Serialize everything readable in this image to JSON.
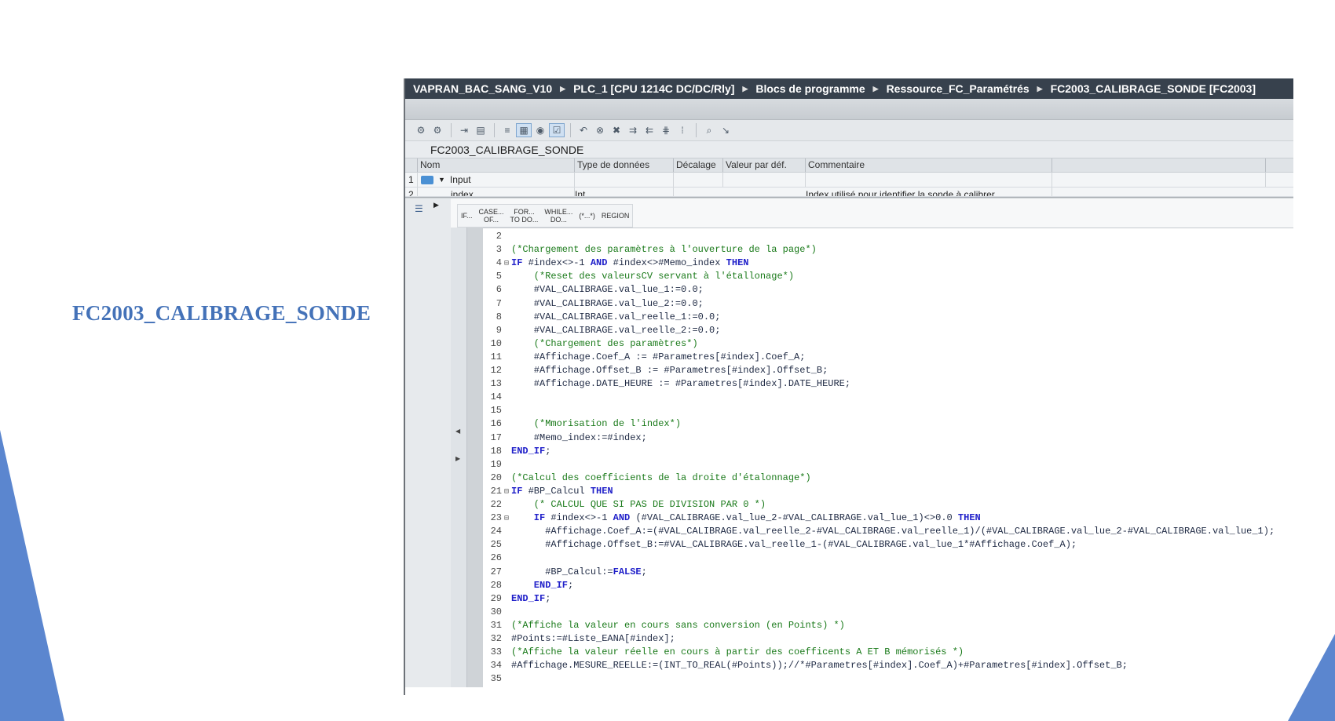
{
  "slide": {
    "title": "FC2003_CALIBRAGE_SONDE"
  },
  "breadcrumb": [
    "VAPRAN_BAC_SANG_V10",
    "PLC_1 [CPU 1214C DC/DC/Rly]",
    "Blocs de programme",
    "Ressource_FC_Paramétrés",
    "FC2003_CALIBRAGE_SONDE [FC2003]"
  ],
  "toolbar": {
    "icons": [
      "compile-icon",
      "compile-all-icon",
      "download-icon",
      "monitor-icon",
      "list-icon",
      "outline-icon",
      "watch-icon",
      "snapshot-icon",
      "bookmark-icon",
      "close-bookmark-icon",
      "delete-icon",
      "indent-icon",
      "outdent-icon",
      "comment-icon",
      "uncomment-icon",
      "zoom-icon",
      "arrow-icon"
    ]
  },
  "block": {
    "name": "FC2003_CALIBRAGE_SONDE"
  },
  "interface": {
    "columns": {
      "num": "",
      "name": "Nom",
      "type": "Type de données",
      "offset": "Décalage",
      "default": "Valeur par déf.",
      "comment": "Commentaire"
    },
    "rows": [
      {
        "num": "1",
        "name": "Input",
        "type": "",
        "comment": ""
      },
      {
        "num": "2",
        "name": "index",
        "type": "Int",
        "comment": "Index utilisé pour identifier la sonde à calibrer"
      }
    ]
  },
  "snippets": [
    "IF...",
    "CASE...\nOF...",
    "FOR...\nTO DO...",
    "WHILE...\nDO...",
    "(*...*)",
    "REGION"
  ],
  "code_lines": [
    {
      "n": "2",
      "fold": "",
      "parts": []
    },
    {
      "n": "3",
      "fold": "",
      "parts": [
        {
          "t": "cm",
          "v": "(*Chargement des paramètres à l'ouverture de la page*)"
        }
      ]
    },
    {
      "n": "4",
      "fold": "⊟",
      "parts": [
        {
          "t": "kw",
          "v": "IF"
        },
        {
          "t": "tx",
          "v": " #index<>-1 "
        },
        {
          "t": "kw",
          "v": "AND"
        },
        {
          "t": "tx",
          "v": " #index<>#Memo_index "
        },
        {
          "t": "kw",
          "v": "THEN"
        }
      ]
    },
    {
      "n": "5",
      "fold": "",
      "parts": [
        {
          "t": "cm",
          "v": "    (*Reset des valeursCV servant à l'étallonage*)"
        }
      ]
    },
    {
      "n": "6",
      "fold": "",
      "parts": [
        {
          "t": "tx",
          "v": "    #VAL_CALIBRAGE.val_lue_1:=0.0;"
        }
      ]
    },
    {
      "n": "7",
      "fold": "",
      "parts": [
        {
          "t": "tx",
          "v": "    #VAL_CALIBRAGE.val_lue_2:=0.0;"
        }
      ]
    },
    {
      "n": "8",
      "fold": "",
      "parts": [
        {
          "t": "tx",
          "v": "    #VAL_CALIBRAGE.val_reelle_1:=0.0;"
        }
      ]
    },
    {
      "n": "9",
      "fold": "",
      "parts": [
        {
          "t": "tx",
          "v": "    #VAL_CALIBRAGE.val_reelle_2:=0.0;"
        }
      ]
    },
    {
      "n": "10",
      "fold": "",
      "parts": [
        {
          "t": "cm",
          "v": "    (*Chargement des paramètres*)"
        }
      ]
    },
    {
      "n": "11",
      "fold": "",
      "parts": [
        {
          "t": "tx",
          "v": "    #Affichage.Coef_A := #Parametres[#index].Coef_A;"
        }
      ]
    },
    {
      "n": "12",
      "fold": "",
      "parts": [
        {
          "t": "tx",
          "v": "    #Affichage.Offset_B := #Parametres[#index].Offset_B;"
        }
      ]
    },
    {
      "n": "13",
      "fold": "",
      "parts": [
        {
          "t": "tx",
          "v": "    #Affichage.DATE_HEURE := #Parametres[#index].DATE_HEURE;"
        }
      ]
    },
    {
      "n": "14",
      "fold": "",
      "parts": []
    },
    {
      "n": "15",
      "fold": "",
      "parts": []
    },
    {
      "n": "16",
      "fold": "",
      "parts": [
        {
          "t": "cm",
          "v": "    (*Mmorisation de l'index*)"
        }
      ]
    },
    {
      "n": "17",
      "fold": "",
      "parts": [
        {
          "t": "tx",
          "v": "    #Memo_index:=#index;"
        }
      ]
    },
    {
      "n": "18",
      "fold": "",
      "parts": [
        {
          "t": "kw",
          "v": "END_IF"
        },
        {
          "t": "tx",
          "v": ";"
        }
      ]
    },
    {
      "n": "19",
      "fold": "",
      "parts": []
    },
    {
      "n": "20",
      "fold": "",
      "parts": [
        {
          "t": "cm",
          "v": "(*Calcul des coefficients de la droite d'étalonnage*)"
        }
      ]
    },
    {
      "n": "21",
      "fold": "⊟",
      "parts": [
        {
          "t": "kw",
          "v": "IF"
        },
        {
          "t": "tx",
          "v": " #BP_Calcul "
        },
        {
          "t": "kw",
          "v": "THEN"
        }
      ]
    },
    {
      "n": "22",
      "fold": "",
      "parts": [
        {
          "t": "cm",
          "v": "    (* CALCUL QUE SI PAS DE DIVISION PAR 0 *)"
        }
      ]
    },
    {
      "n": "23",
      "fold": "⊟",
      "parts": [
        {
          "t": "kw",
          "v": "    IF"
        },
        {
          "t": "tx",
          "v": " #index<>-1 "
        },
        {
          "t": "kw",
          "v": "AND"
        },
        {
          "t": "tx",
          "v": " (#VAL_CALIBRAGE.val_lue_2-#VAL_CALIBRAGE.val_lue_1)<>0.0 "
        },
        {
          "t": "kw",
          "v": "THEN"
        }
      ]
    },
    {
      "n": "24",
      "fold": "",
      "parts": [
        {
          "t": "tx",
          "v": "      #Affichage.Coef_A:=(#VAL_CALIBRAGE.val_reelle_2-#VAL_CALIBRAGE.val_reelle_1)/(#VAL_CALIBRAGE.val_lue_2-#VAL_CALIBRAGE.val_lue_1);"
        }
      ]
    },
    {
      "n": "25",
      "fold": "",
      "parts": [
        {
          "t": "tx",
          "v": "      #Affichage.Offset_B:=#VAL_CALIBRAGE.val_reelle_1-(#VAL_CALIBRAGE.val_lue_1*#Affichage.Coef_A);"
        }
      ]
    },
    {
      "n": "26",
      "fold": "",
      "parts": []
    },
    {
      "n": "27",
      "fold": "",
      "parts": [
        {
          "t": "tx",
          "v": "      #BP_Calcul:="
        },
        {
          "t": "kw",
          "v": "FALSE"
        },
        {
          "t": "tx",
          "v": ";"
        }
      ]
    },
    {
      "n": "28",
      "fold": "",
      "parts": [
        {
          "t": "kw",
          "v": "    END_IF"
        },
        {
          "t": "tx",
          "v": ";"
        }
      ]
    },
    {
      "n": "29",
      "fold": "",
      "parts": [
        {
          "t": "kw",
          "v": "END_IF"
        },
        {
          "t": "tx",
          "v": ";"
        }
      ]
    },
    {
      "n": "30",
      "fold": "",
      "parts": []
    },
    {
      "n": "31",
      "fold": "",
      "parts": [
        {
          "t": "cm",
          "v": "(*Affiche la valeur en cours sans conversion (en Points) *)"
        }
      ]
    },
    {
      "n": "32",
      "fold": "",
      "parts": [
        {
          "t": "tx",
          "v": "#Points:=#Liste_EANA[#index];"
        }
      ]
    },
    {
      "n": "33",
      "fold": "",
      "parts": [
        {
          "t": "cm",
          "v": "(*Affiche la valeur réelle en cours à partir des coefficents A ET B mémorisés *)"
        }
      ]
    },
    {
      "n": "34",
      "fold": "",
      "parts": [
        {
          "t": "tx",
          "v": "#Affichage.MESURE_REELLE:=(INT_TO_REAL(#Points));//*#Parametres[#index].Coef_A)+#Parametres[#index].Offset_B;"
        }
      ]
    },
    {
      "n": "35",
      "fold": "",
      "parts": []
    }
  ],
  "colors": {
    "accent": "#4472b8",
    "titlebar": "#37414d",
    "keyword": "#1f1fc9",
    "comment": "#1a7a1a"
  }
}
